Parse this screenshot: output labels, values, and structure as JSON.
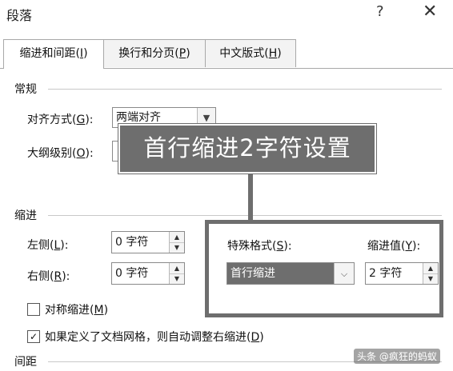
{
  "window": {
    "title": "段落",
    "help_glyph": "?",
    "close_glyph": "✕"
  },
  "tabs": [
    {
      "label": "缩进和间距(",
      "key": "I",
      "suffix": ")",
      "active": true
    },
    {
      "label": "换行和分页(",
      "key": "P",
      "suffix": ")",
      "active": false
    },
    {
      "label": "中文版式(",
      "key": "H",
      "suffix": ")",
      "active": false
    }
  ],
  "general": {
    "heading": "常规",
    "alignment_label": "对齐方式(",
    "alignment_key": "G",
    "alignment_suffix": "):",
    "alignment_value": "两端对齐",
    "outline_label": "大纲级别(",
    "outline_key": "O",
    "outline_suffix": "):"
  },
  "indent": {
    "heading": "缩进",
    "left_label": "左侧(",
    "left_key": "L",
    "left_suffix": "):",
    "left_value": "0 字符",
    "right_label": "右侧(",
    "right_key": "R",
    "right_suffix": "):",
    "right_value": "0 字符",
    "special_label": "特殊格式(",
    "special_key": "S",
    "special_suffix": "):",
    "special_value": "首行缩进",
    "by_label": "缩进值(",
    "by_key": "Y",
    "by_suffix": "):",
    "by_value": "2 字符",
    "mirror_label": "对称缩进(",
    "mirror_key": "M",
    "mirror_suffix": ")",
    "mirror_checked": false,
    "grid_label": "如果定义了文档网格，则自动调整右缩进(",
    "grid_key": "D",
    "grid_suffix": ")",
    "grid_checked": true
  },
  "spacing": {
    "heading": "间距"
  },
  "annotation": {
    "callout_text": "首行缩进2字符设置"
  },
  "watermark": {
    "text": "头条 @疯狂的蚂蚁"
  },
  "colors": {
    "annotation": "#6e6e6e",
    "selection": "#6e6e6e"
  }
}
